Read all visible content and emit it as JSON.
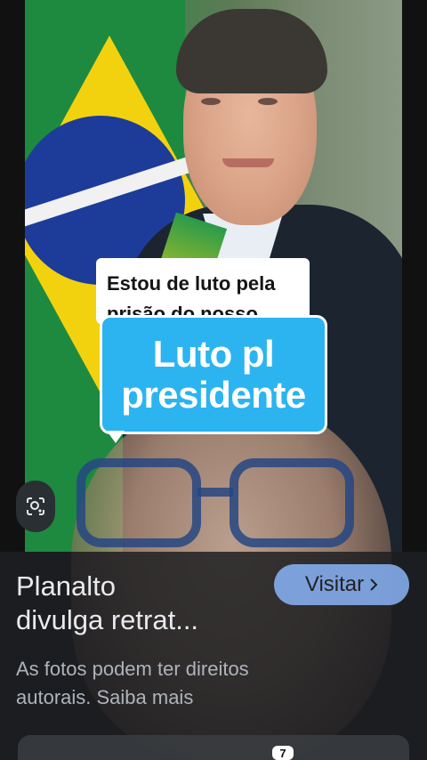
{
  "overlay": {
    "caption_top": [
      "Estou de luto pela",
      "prisão do nosso"
    ],
    "caption_main": [
      "Luto pl",
      "presidente"
    ]
  },
  "result_card": {
    "title_lines": [
      "Planalto",
      "divulga retrat..."
    ],
    "visit_label": "Visitar",
    "note_lines": [
      "As fotos podem ter direitos",
      "autorais. Saiba mais"
    ],
    "badge": "7"
  },
  "icons": {
    "lens": "lens-icon",
    "visit_arrow": "chevron-right-icon"
  },
  "colors": {
    "caption_blue": "#2bb4f0",
    "visit_button": "#8ab4f8",
    "panel": "#202124"
  }
}
